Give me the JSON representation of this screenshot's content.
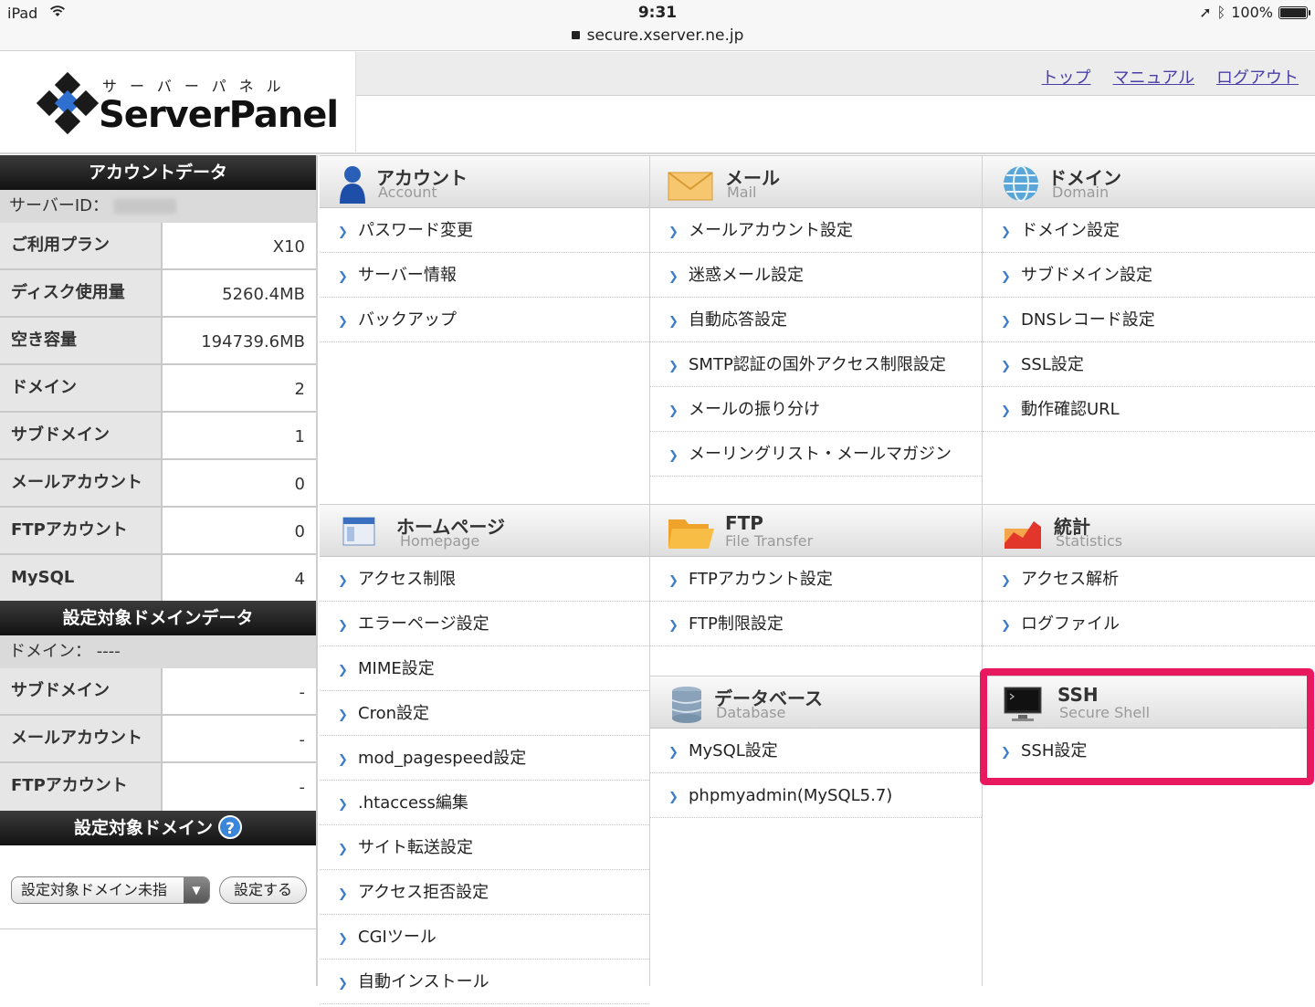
{
  "status_bar": {
    "device": "iPad",
    "time": "9:31",
    "url": "secure.xserver.ne.jp",
    "battery": "100%"
  },
  "header": {
    "logo_kana": "サーバーパネル",
    "logo_text": "ServerPanel",
    "links": [
      "トップ",
      "マニュアル",
      "ログアウト"
    ]
  },
  "sidebar": {
    "account_title": "アカウントデータ",
    "server_id_label": "サーバーID：",
    "account_rows": [
      {
        "label": "ご利用プラン",
        "value": "X10"
      },
      {
        "label": "ディスク使用量",
        "value": "5260.4MB"
      },
      {
        "label": "空き容量",
        "value": "194739.6MB"
      },
      {
        "label": "ドメイン",
        "value": "2"
      },
      {
        "label": "サブドメイン",
        "value": "1"
      },
      {
        "label": "メールアカウント",
        "value": "0"
      },
      {
        "label": "FTPアカウント",
        "value": "0"
      },
      {
        "label": "MySQL",
        "value": "4"
      }
    ],
    "target_title": "設定対象ドメインデータ",
    "target_domain_label": "ドメイン：",
    "target_domain_value": "----",
    "target_rows": [
      {
        "label": "サブドメイン",
        "value": "-"
      },
      {
        "label": "メールアカウント",
        "value": "-"
      },
      {
        "label": "FTPアカウント",
        "value": "-"
      }
    ],
    "domain_select_title": "設定対象ドメイン",
    "help_glyph": "?",
    "select_value": "設定対象ドメイン未指",
    "set_button": "設定する"
  },
  "sections": {
    "account": {
      "jp": "アカウント",
      "en": "Account",
      "items": [
        "パスワード変更",
        "サーバー情報",
        "バックアップ"
      ]
    },
    "mail": {
      "jp": "メール",
      "en": "Mail",
      "items": [
        "メールアカウント設定",
        "迷惑メール設定",
        "自動応答設定",
        "SMTP認証の国外アクセス制限設定",
        "メールの振り分け",
        "メーリングリスト・メールマガジン"
      ]
    },
    "domain": {
      "jp": "ドメイン",
      "en": "Domain",
      "items": [
        "ドメイン設定",
        "サブドメイン設定",
        "DNSレコード設定",
        "SSL設定",
        "動作確認URL"
      ]
    },
    "homepage": {
      "jp": "ホームページ",
      "en": "Homepage",
      "items": [
        "アクセス制限",
        "エラーページ設定",
        "MIME設定",
        "Cron設定",
        "mod_pagespeed設定",
        ".htaccess編集",
        "サイト転送設定",
        "アクセス拒否設定",
        "CGIツール",
        "自動インストール"
      ]
    },
    "ftp": {
      "jp": "FTP",
      "en": "File Transfer",
      "items": [
        "FTPアカウント設定",
        "FTP制限設定"
      ]
    },
    "stats": {
      "jp": "統計",
      "en": "Statistics",
      "items": [
        "アクセス解析",
        "ログファイル"
      ]
    },
    "database": {
      "jp": "データベース",
      "en": "Database",
      "items": [
        "MySQL設定",
        "phpmyadmin(MySQL5.7)"
      ]
    },
    "ssh": {
      "jp": "SSH",
      "en": "Secure Shell",
      "items": [
        "SSH設定"
      ]
    }
  },
  "colors": {
    "highlight": "#e8195f",
    "link": "#4a3fa7",
    "bullet": "#3d7cc9"
  }
}
